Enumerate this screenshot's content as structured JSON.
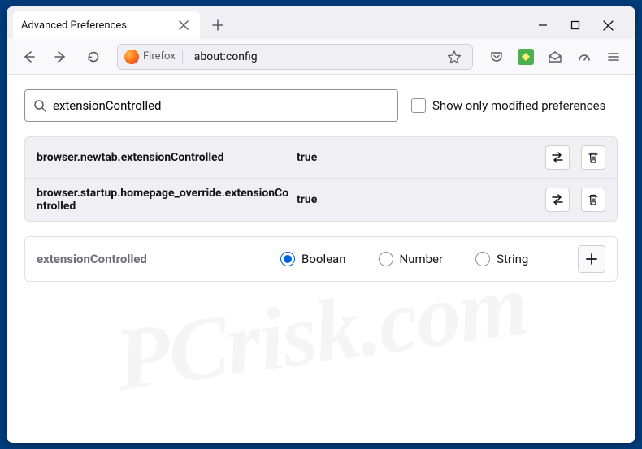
{
  "tab": {
    "title": "Advanced Preferences"
  },
  "urlbar": {
    "identity": "Firefox",
    "url": "about:config"
  },
  "filter": {
    "value": "extensionControlled",
    "show_modified_label": "Show only modified preferences",
    "show_modified_checked": false
  },
  "prefs": [
    {
      "name": "browser.newtab.extensionControlled",
      "value": "true"
    },
    {
      "name": "browser.startup.homepage_override.extensionControlled",
      "value": "true"
    }
  ],
  "new_pref": {
    "name": "extensionControlled",
    "types": [
      "Boolean",
      "Number",
      "String"
    ],
    "selected": "Boolean"
  },
  "watermark": "PCrisk.com",
  "colors": {
    "accent": "#0060df"
  }
}
